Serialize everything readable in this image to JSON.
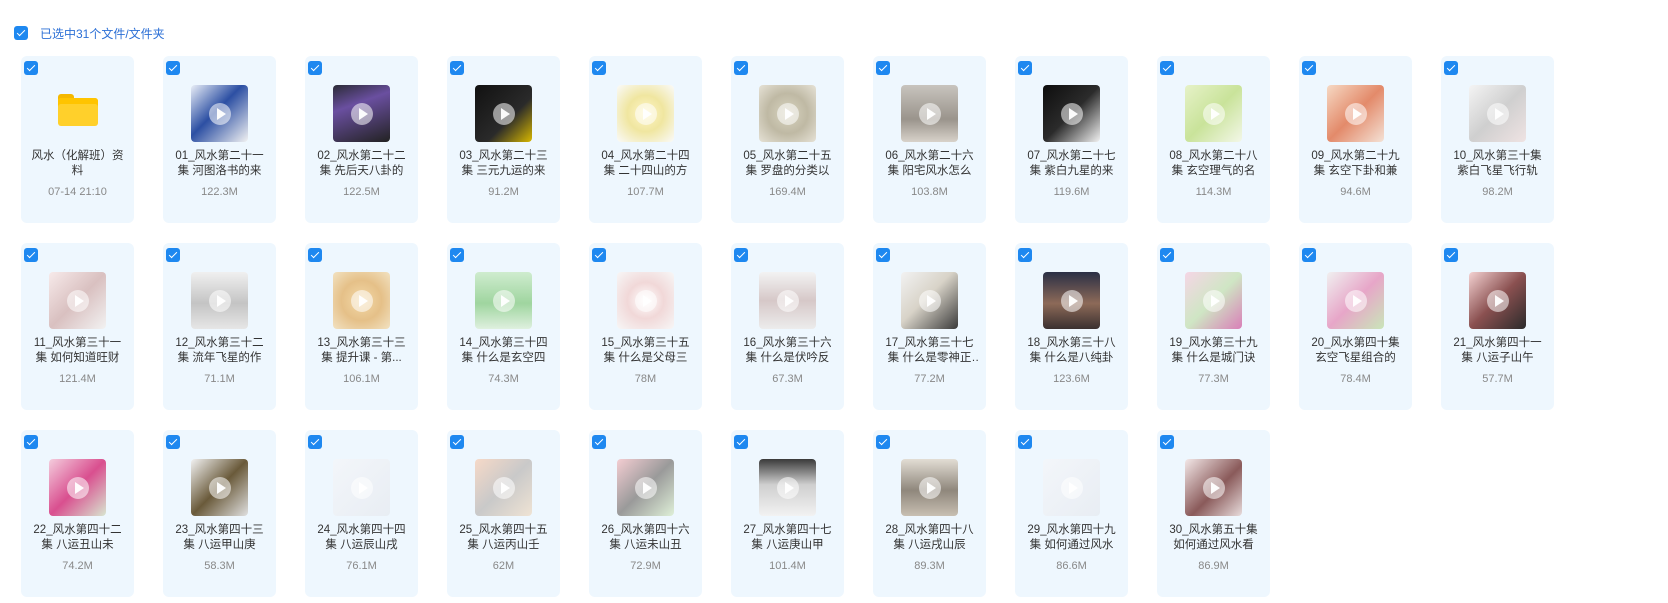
{
  "header": {
    "selection_label": "已选中31个文件/文件夹"
  },
  "items": [
    {
      "type": "folder",
      "name": "风水（化解班）资料",
      "meta": "07-14 21:10",
      "icon": "folder-icon",
      "thumb": "#ffd02b"
    },
    {
      "type": "video",
      "name": "01_风水第二十一集 河图洛书的来",
      "meta": "122.3M",
      "thumb": "linear-gradient(135deg,#e9eef7 0%,#2c4fa3 45%,#f2f2f2 100%)"
    },
    {
      "type": "video",
      "name": "02_风水第二十二集 先后天八卦的",
      "meta": "122.5M",
      "thumb": "linear-gradient(160deg,#2b2b36 0%,#6a4fa0 35%,#222 100%)"
    },
    {
      "type": "video",
      "name": "03_风水第二十三集 三元九运的来",
      "meta": "91.2M",
      "thumb": "linear-gradient(135deg,#111 0%,#2a2a2a 60%,#d8b800 100%)"
    },
    {
      "type": "video",
      "name": "04_风水第二十四集 二十四山的方",
      "meta": "107.7M",
      "thumb": "radial-gradient(circle,#fff6c8 0%,#f0e6a0 45%,#fafafa 100%)"
    },
    {
      "type": "video",
      "name": "05_风水第二十五集 罗盘的分类以",
      "meta": "169.4M",
      "thumb": "radial-gradient(circle,#d8d4c0 0%,#bfb9a4 50%,#e6e2d6 100%)"
    },
    {
      "type": "video",
      "name": "06_风水第二十六集 阳宅风水怎么",
      "meta": "103.8M",
      "thumb": "linear-gradient(180deg,#c8c4be 0%,#9a948c 60%,#d8d2ca 100%)"
    },
    {
      "type": "video",
      "name": "07_风水第二十七集 紫白九星的来",
      "meta": "119.6M",
      "thumb": "linear-gradient(135deg,#0d0d0d 0%,#2b2b2b 50%,#f2f2f2 100%)"
    },
    {
      "type": "video",
      "name": "08_风水第二十八集 玄空理气的名",
      "meta": "114.3M",
      "thumb": "linear-gradient(135deg,#e6f2c8 0%,#c9e39a 50%,#f3f7e8 100%)"
    },
    {
      "type": "video",
      "name": "09_风水第二十九集 玄空下卦和兼",
      "meta": "94.6M",
      "thumb": "linear-gradient(135deg,#f6d9c4 0%,#e38a6a 50%,#f4e2d6 100%)"
    },
    {
      "type": "video",
      "name": "10_风水第三十集 紫白飞星飞行轨",
      "meta": "98.2M",
      "thumb": "linear-gradient(135deg,#f4f4f4 0%,#cfcfcf 50%,#efe3e3 100%)"
    },
    {
      "type": "video",
      "name": "11_风水第三十一集 如何知道旺财",
      "meta": "121.4M",
      "thumb": "linear-gradient(135deg,#f7eaea 0%,#d9c0c0 50%,#f2f2f2 100%)"
    },
    {
      "type": "video",
      "name": "12_风水第三十二集 流年飞星的作",
      "meta": "71.1M",
      "thumb": "linear-gradient(180deg,#f0f0f0 0%,#c4c4c4 55%,#e6e6e6 100%)"
    },
    {
      "type": "video",
      "name": "13_风水第三十三集 提升课 - 第...",
      "meta": "106.1M",
      "thumb": "radial-gradient(circle,#f3d9a8 0%,#e5c088 50%,#f2e2c2 100%)"
    },
    {
      "type": "video",
      "name": "14_风水第三十四集 什么是玄空四",
      "meta": "74.3M",
      "thumb": "linear-gradient(180deg,#cfeccf 0%,#9fd59f 55%,#dff0df 100%)"
    },
    {
      "type": "video",
      "name": "15_风水第三十五集 什么是父母三",
      "meta": "78M",
      "thumb": "radial-gradient(circle,#ffffff 0%,#f1d8d8 45%,#f7f7f7 100%)"
    },
    {
      "type": "video",
      "name": "16_风水第三十六集 什么是伏吟反",
      "meta": "67.3M",
      "thumb": "linear-gradient(180deg,#f3f3f3 0%,#d6c8c8 50%,#ececec 100%)"
    },
    {
      "type": "video",
      "name": "17_风水第三十七集 什么是零神正神...",
      "meta": "77.2M",
      "thumb": "linear-gradient(135deg,#f2f2f2 0%,#d8d3c8 45%,#3a3a3a 100%)"
    },
    {
      "type": "video",
      "name": "18_风水第三十八集 什么是八纯卦",
      "meta": "123.6M",
      "thumb": "linear-gradient(180deg,#2a2f45 0%,#8d6a58 55%,#3a3030 100%)"
    },
    {
      "type": "video",
      "name": "19_风水第三十九集 什么是城门诀",
      "meta": "77.3M",
      "thumb": "linear-gradient(135deg,#f5d6e6 0%,#cfe6c4 50%,#d97fb8 100%)"
    },
    {
      "type": "video",
      "name": "20_风水第四十集 玄空飞星组合的",
      "meta": "78.4M",
      "thumb": "linear-gradient(135deg,#f0f0f0 0%,#e7a6c8 50%,#c9e6b9 100%)"
    },
    {
      "type": "video",
      "name": "21_风水第四十一集 八运子山午",
      "meta": "57.7M",
      "thumb": "linear-gradient(135deg,#f4d2d2 0%,#8a5050 50%,#2b2b2b 100%)"
    },
    {
      "type": "video",
      "name": "22_风水第四十二集 八运丑山未",
      "meta": "74.2M",
      "thumb": "linear-gradient(135deg,#f4cddd 0%,#d94f8f 50%,#d8e6d0 100%)"
    },
    {
      "type": "video",
      "name": "23_风水第四十三集 八运甲山庚",
      "meta": "58.3M",
      "thumb": "linear-gradient(135deg,#f2f2f2 0%,#6a5a3a 50%,#e0e0e0 100%)"
    },
    {
      "type": "video",
      "name": "24_风水第四十四集 八运辰山戌",
      "meta": "76.1M",
      "thumb": "linear-gradient(135deg,#f3f6fa 0%,#e8edf3 100%)"
    },
    {
      "type": "video",
      "name": "25_风水第四十五集 八运丙山壬",
      "meta": "62M",
      "thumb": "linear-gradient(135deg,#f6d9c8 0%,#c9c9c9 50%,#efe3d4 100%)"
    },
    {
      "type": "video",
      "name": "26_风水第四十六集 八运未山丑",
      "meta": "72.9M",
      "thumb": "linear-gradient(135deg,#f4cdd2 0%,#9a9a9a 50%,#dff0d8 100%)"
    },
    {
      "type": "video",
      "name": "27_风水第四十七集 八运庚山甲",
      "meta": "101.4M",
      "thumb": "linear-gradient(180deg,#3a3a3a 0%,#cfcfcf 45%,#f2f2f2 100%)"
    },
    {
      "type": "video",
      "name": "28_风水第四十八集 八运戌山辰",
      "meta": "89.3M",
      "thumb": "linear-gradient(180deg,#e2ddd4 0%,#8f877c 55%,#c8bfb2 100%)"
    },
    {
      "type": "video",
      "name": "29_风水第四十九集 如何通过风水",
      "meta": "86.6M",
      "thumb": "linear-gradient(135deg,#f3f6fa 0%,#e8edf3 100%)"
    },
    {
      "type": "video",
      "name": "30_风水第五十集 如何通过风水看",
      "meta": "86.9M",
      "thumb": "linear-gradient(135deg,#f3e8e8 0%,#8a5a5a 55%,#e8dcdc 100%)"
    }
  ]
}
